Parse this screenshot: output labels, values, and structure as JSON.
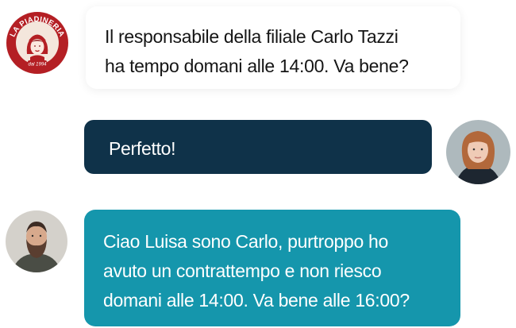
{
  "brand": {
    "arc_text": "LA PIADINERIA",
    "since_text": "dal 1994",
    "color": "#b41f24"
  },
  "messages": [
    {
      "sender": "brand",
      "lines": [
        "Il responsabile della filiale Carlo Tazzi",
        "ha tempo domani alle 14:00. Va bene?"
      ],
      "bg": "#ffffff"
    },
    {
      "sender": "Luisa",
      "lines": [
        "Perfetto!"
      ],
      "bg": "#0f3249"
    },
    {
      "sender": "Carlo",
      "lines": [
        "Ciao Luisa sono Carlo, purtroppo ho",
        "avuto un contrattempo e non riesco",
        "domani alle 14:00. Va bene alle 16:00?"
      ],
      "bg": "#1596ac"
    }
  ]
}
